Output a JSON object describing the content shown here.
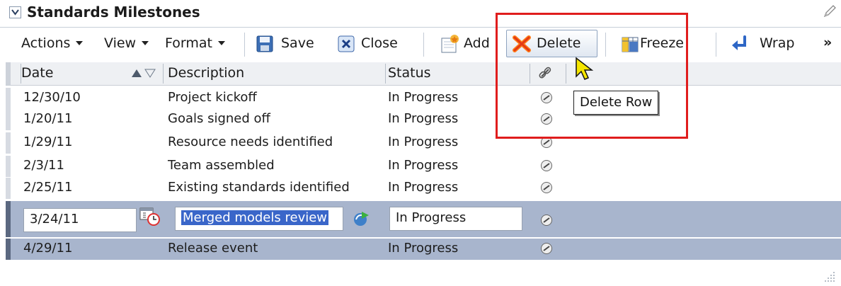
{
  "panel": {
    "title": "Standards Milestones"
  },
  "toolbar": {
    "actions": "Actions",
    "view": "View",
    "format": "Format",
    "save": "Save",
    "close": "Close",
    "add": "Add",
    "delete": "Delete",
    "freeze": "Freeze",
    "wrap": "Wrap",
    "overflow": "»"
  },
  "table": {
    "headers": {
      "date": "Date",
      "description": "Description",
      "status": "Status"
    },
    "rows": [
      {
        "date": "12/30/10",
        "description": "Project kickoff",
        "status": "In Progress"
      },
      {
        "date": "1/20/11",
        "description": "Goals signed off",
        "status": "In Progress"
      },
      {
        "date": "1/29/11",
        "description": "Resource needs identified",
        "status": "In Progress"
      },
      {
        "date": "2/3/11",
        "description": "Team assembled",
        "status": "In Progress"
      },
      {
        "date": "2/25/11",
        "description": "Existing standards identified",
        "status": "In Progress"
      },
      {
        "date": "3/24/11",
        "description": "Merged models review",
        "status": "In Progress"
      },
      {
        "date": "4/29/11",
        "description": "Release event",
        "status": "In Progress"
      }
    ]
  },
  "tooltip": {
    "text": "Delete Row"
  },
  "colors": {
    "highlight": "#e01d1d",
    "selected_row": "#a8b5cd",
    "text_selection": "#3a66c9"
  },
  "icons": [
    "chevron-down-icon",
    "pencil-icon",
    "save-icon",
    "close-icon",
    "add-icon",
    "delete-icon",
    "freeze-icon",
    "wrap-icon",
    "sort-icon",
    "link-icon",
    "calendar-icon",
    "refresh-icon",
    "cursor-icon",
    "resize-grip-icon"
  ]
}
